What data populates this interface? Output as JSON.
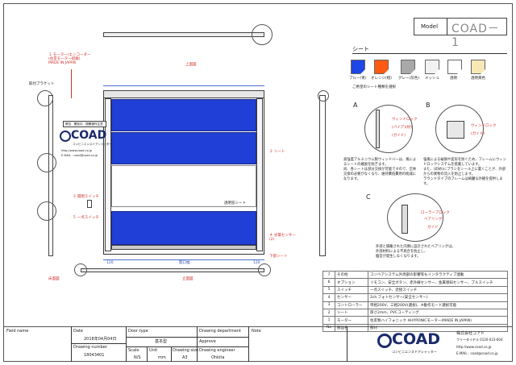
{
  "model": {
    "label": "Model",
    "value": "COAD－1"
  },
  "sheet": {
    "title": "シート",
    "note": "ご希望のシート種類を選択",
    "swatches": [
      {
        "label": "ブルー(青)",
        "color": "#1f46e6"
      },
      {
        "label": "オレンジ(橙)",
        "color": "#ff5a14"
      },
      {
        "label": "グレー(灰色)",
        "color": "#a9a9a9"
      },
      {
        "label": "メッシュ",
        "color": "#f2f2f2"
      },
      {
        "label": "透明",
        "color": "#ffffff"
      },
      {
        "label": "透明黄色",
        "color": "#f6e7b5"
      }
    ]
  },
  "annotations": {
    "motor": "１ モーター/エンコーダー\n(住友モーター搭載)\nMADE IN JAPAN",
    "bracket_label": "取付ブラケット",
    "warning_label": "警告　開放中　閉開操作注意",
    "sheet_label": "２ シート",
    "clear_label": "透明窓シート",
    "switch1": "３ 開閉スイッチ",
    "switch2": "５ 一点スイッチ",
    "photo_sensor": "４ 光電センサー\n(2)",
    "bottom_sheet": "下部シート",
    "floor_plan": "床面図",
    "elevation": "立面図",
    "top_view": "上面図",
    "dim_top": "有効幅W",
    "dim_bottom": "開口幅",
    "dim_side": "120",
    "dim_w": "120"
  },
  "brand": {
    "logo": "COAD",
    "tagline": "コンビニエンスドアシャッター",
    "site": "http://www.coad.co.jp",
    "mail": "E-MAIL : coad@coad.co.jp"
  },
  "details": {
    "A": {
      "letter": "A",
      "c1": "ウィンドロック",
      "c2": "(バイア)(材)",
      "c3": "(ガイド)"
    },
    "B": {
      "letter": "B",
      "c1": "ウィンドロック",
      "c2": "(ガイド)"
    },
    "C": {
      "letter": "C",
      "c1": "ローラーブロック",
      "c2": "ベアリング",
      "c3": "ガイド"
    },
    "desc_left": "高強度アルミニウム製ウィンドバーは、風によるシートの離脱を防ぎます。\n尚、各シートは部分交換が可能ですので、全体交換の必要がなくなり、維持費低費用の削減になります。",
    "desc_right": "強風による破損や変形を防ぐため、フレームにウィンドロックシステムを搭載しています。\nまた、(斜め)にブラシをシール上に置くことが、外部からの異物の流入を防止します。\nラウンドタイプのフレームは綺麗な外観を提供します。",
    "desc_c": "外部と隔離された内側に設計されたベアリングは、\n外部材料による不具合を防止し、\n騒音が発生しなくなります。"
  },
  "spec_table": {
    "rows": [
      {
        "no": "7",
        "item": "その他",
        "desc": "コンベアシステム外周部の影響等もインタラクティブ連動"
      },
      {
        "no": "6",
        "item": "オプション",
        "desc": "リモコン、安全ボタン、赤外線センサー、金属感知センサー、プルスイッチ"
      },
      {
        "no": "5",
        "item": "スイッチ",
        "desc": "一点スイッチ、近接スイッチ"
      },
      {
        "no": "4",
        "item": "センサー",
        "desc": "2ch フォトセンサー(安全センサー)"
      },
      {
        "no": "3",
        "item": "コントローラー",
        "desc": "単相200V、三相200V(選択)、※動作モード選択可能"
      },
      {
        "no": "2",
        "item": "シート",
        "desc": "厚さ2mm、PVCコーティング"
      },
      {
        "no": "1",
        "item": "モーター",
        "desc": "住友製ハイフォニック ※HYPONICモーター(MADE IN JAPAN)"
      },
      {
        "no": "No",
        "item": "部品名",
        "desc": "部材"
      }
    ]
  },
  "title_block": {
    "field_name": "Field name",
    "date_label": "Date",
    "date_value": "2018年04月04日",
    "drawing_number_label": "Drawing number",
    "drawing_number_value": "18043401",
    "door_type_label": "Door type",
    "door_type_value": "基本型",
    "scale_label": "Scale",
    "scale_value": "N/S",
    "unit_label": "Unit",
    "unit_value": "mm",
    "size_label": "Drawing size",
    "size_value": "A3",
    "dept_label": "Drawing department",
    "approve_label": "Approve",
    "engineer_label": "Drawing engineer",
    "engineer_value": "Ohkita",
    "note_label": "Note",
    "company": "株式会社コアド",
    "tel": "フリーダイヤル 0120-023-604",
    "site": "http://www.coad.co.jp",
    "mail": "E-MAIL : coad@coad.co.jp",
    "logo": "COAD",
    "tagline": "コンビニエンスドアシャッター"
  }
}
